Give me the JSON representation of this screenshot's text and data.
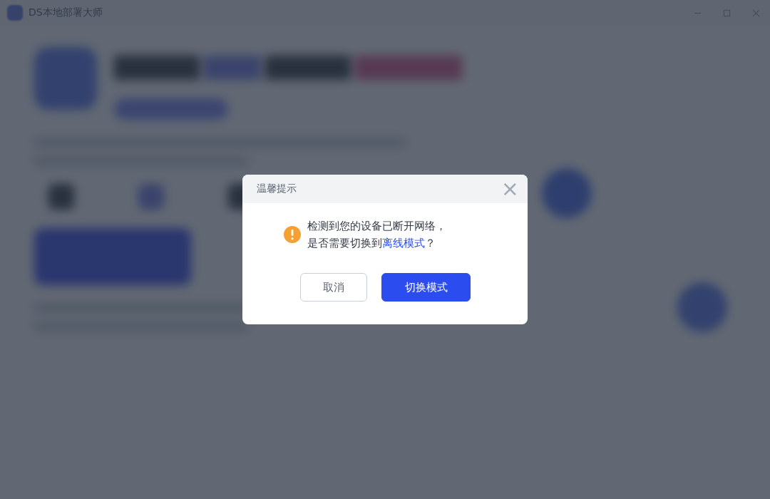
{
  "window": {
    "title": "DS本地部署大师"
  },
  "dialog": {
    "title": "温馨提示",
    "close": "×",
    "message": {
      "line1": "检测到您的设备已断开网络，",
      "line2_before": "是否需要切换到",
      "link": "离线模式",
      "line2_after": "？"
    },
    "buttons": [
      {
        "label": "取消",
        "kind": "secondary"
      },
      {
        "label": "切换模式",
        "kind": "primary"
      }
    ]
  }
}
